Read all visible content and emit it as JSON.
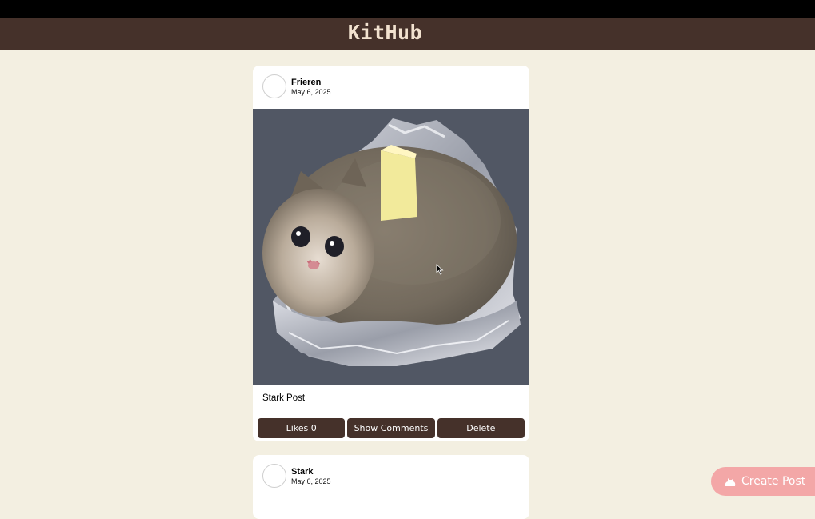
{
  "app": {
    "brand": "KitHub"
  },
  "posts": [
    {
      "author": "Frieren",
      "date": "May 6, 2025",
      "image": "crying-cat-baked-potato",
      "caption": "Stark Post",
      "likes_label": "Likes 0",
      "comments_label": "Show Comments",
      "delete_label": "Delete"
    },
    {
      "author": "Stark",
      "date": "May 6, 2025"
    }
  ],
  "fab": {
    "label": "Create Post",
    "icon": "cat-icon"
  },
  "colors": {
    "background": "#f3efe1",
    "header": "#45312a",
    "brand_text": "#f2e2cf",
    "button": "#45312a",
    "fab": "#f3a7a7"
  }
}
